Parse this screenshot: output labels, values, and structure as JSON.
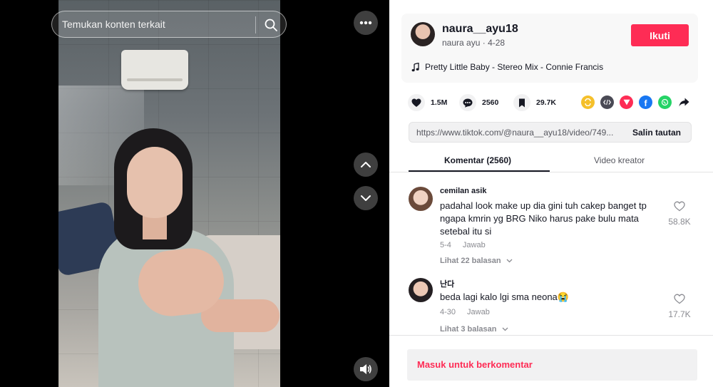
{
  "search": {
    "placeholder": "Temukan konten terkait"
  },
  "author": {
    "username": "naura__ayu18",
    "nickname": "naura ayu",
    "date": "4-28",
    "follow_label": "Ikuti"
  },
  "music": {
    "title": "Pretty Little Baby - Stereo Mix - Connie Francis"
  },
  "stats": {
    "likes": "1.5M",
    "comments": "2560",
    "bookmarks": "29.7K"
  },
  "share_icons": [
    "repost-icon",
    "embed-icon",
    "send-icon",
    "facebook-icon",
    "whatsapp-icon",
    "share-arrow-icon"
  ],
  "link": {
    "url": "https://www.tiktok.com/@naura__ayu18/video/749...",
    "copy_label": "Salin tautan"
  },
  "tabs": [
    {
      "label": "Komentar (2560)",
      "active": true
    },
    {
      "label": "Video kreator",
      "active": false
    }
  ],
  "comments": [
    {
      "user": "cemilan asik",
      "text": "padahal look make up dia gini tuh cakep banget tp ngapa kmrin yg BRG Niko harus pake bulu mata setebal itu si",
      "date": "5-4",
      "reply_label": "Jawab",
      "likes": "58.8K",
      "replies_label": "Lihat 22 balasan"
    },
    {
      "user": "난다",
      "text": "beda lagi kalo lgi sma neona😭",
      "date": "4-30",
      "reply_label": "Jawab",
      "likes": "17.7K",
      "replies_label": "Lihat 3 balasan"
    }
  ],
  "login_prompt": "Masuk untuk berkomentar",
  "colors": {
    "accent": "#fe2c55",
    "text": "#161823",
    "muted": "#8a8b91"
  }
}
